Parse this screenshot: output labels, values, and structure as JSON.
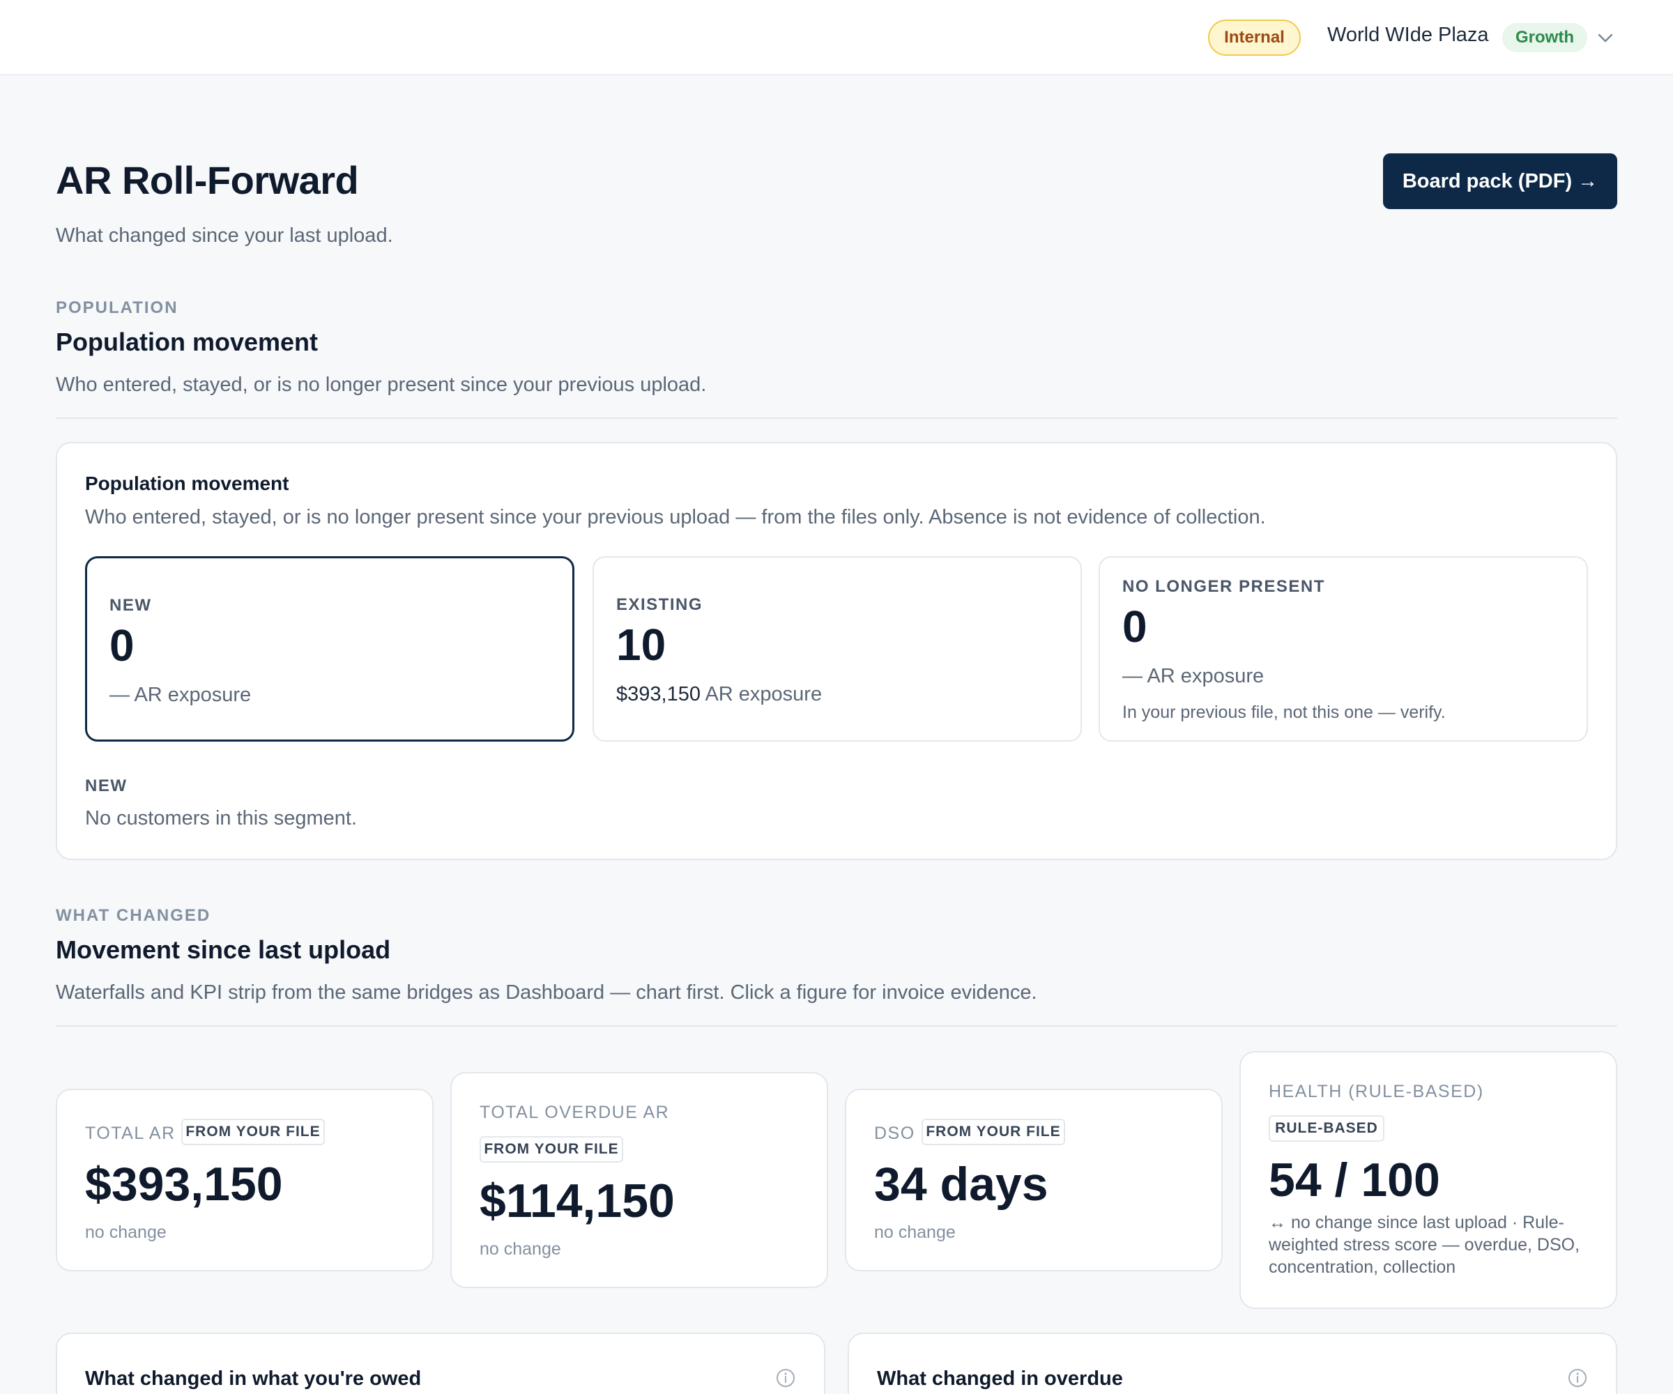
{
  "topbar": {
    "env_badge": "Internal",
    "org_name": "World WIde Plaza",
    "plan_badge": "Growth",
    "menu_icon": "chevron-down-icon"
  },
  "header": {
    "title": "AR Roll-Forward",
    "subtitle": "What changed since your last upload.",
    "board_pack_button": "Board pack (PDF) →"
  },
  "population_section": {
    "eyebrow": "POPULATION",
    "title": "Population movement",
    "description": "Who entered, stayed, or is no longer present since your previous upload."
  },
  "population_card": {
    "title": "Population movement",
    "description": "Who entered, stayed, or is no longer present since your previous upload — from the files only. Absence is not evidence of collection.",
    "tiles": {
      "new": {
        "label": "NEW",
        "count": "0",
        "exposure_value": "—",
        "exposure_label": "AR exposure"
      },
      "existing": {
        "label": "EXISTING",
        "count": "10",
        "exposure_value": "$393,150",
        "exposure_label": "AR exposure"
      },
      "gone": {
        "label": "NO LONGER PRESENT",
        "count": "0",
        "exposure_value": "—",
        "exposure_label": "AR exposure",
        "note": "In your previous file, not this one — verify."
      }
    },
    "segment_label": "NEW",
    "segment_empty": "No customers in this segment."
  },
  "changes_section": {
    "eyebrow": "WHAT CHANGED",
    "title": "Movement since last upload",
    "description": "Waterfalls and KPI strip from the same bridges as Dashboard — chart first. Click a figure for invoice evidence."
  },
  "kpis": {
    "total_ar": {
      "label": "TOTAL AR",
      "tag": "FROM YOUR FILE",
      "value": "$393,150",
      "change": "no change"
    },
    "overdue_ar": {
      "label": "TOTAL OVERDUE AR",
      "tag": "FROM YOUR FILE",
      "value": "$114,150",
      "change": "no change"
    },
    "dso": {
      "label": "DSO",
      "tag": "FROM YOUR FILE",
      "value": "34 days",
      "change": "no change"
    },
    "health": {
      "label": "HEALTH (RULE-BASED)",
      "tag": "RULE-BASED",
      "value": "54 / 100",
      "note": "↔ no change since last upload · Rule-weighted stress score — overdue, DSO, concentration, collection"
    }
  },
  "bottom_cards": {
    "owed": {
      "title": "What changed in what you're owed"
    },
    "overdue": {
      "title": "What changed in overdue"
    }
  },
  "colors": {
    "navy": "#0e2947",
    "background": "#f6f8fa",
    "internal_badge_bg": "#fff5cf",
    "growth_badge_text": "#2a8a4a"
  }
}
